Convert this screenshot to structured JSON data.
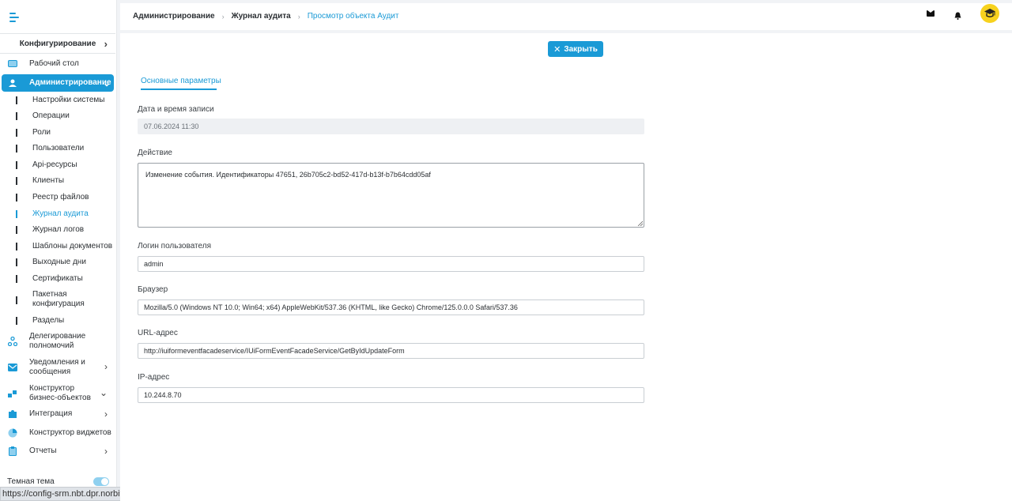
{
  "sidebar": {
    "config_label": "Конфигурирование",
    "items": [
      {
        "label": "Рабочий стол"
      },
      {
        "label": "Администрирование"
      },
      {
        "label": "Делегирование полномочий"
      },
      {
        "label": "Уведомления и сообщения"
      },
      {
        "label": "Конструктор бизнес-объектов"
      },
      {
        "label": "Интеграция"
      },
      {
        "label": "Конструктор виджетов"
      },
      {
        "label": "Отчеты"
      }
    ],
    "subitems": [
      {
        "label": "Настройки системы"
      },
      {
        "label": "Операции"
      },
      {
        "label": "Роли"
      },
      {
        "label": "Пользователи"
      },
      {
        "label": "Api-ресурсы"
      },
      {
        "label": "Клиенты"
      },
      {
        "label": "Реестр файлов"
      },
      {
        "label": "Журнал аудита"
      },
      {
        "label": "Журнал логов"
      },
      {
        "label": "Шаблоны документов"
      },
      {
        "label": "Выходные дни"
      },
      {
        "label": "Сертификаты"
      },
      {
        "label": "Пакетная конфигурация"
      },
      {
        "label": "Разделы"
      }
    ],
    "theme_label": "Темная тема"
  },
  "status_url": "https://config-srm.nbt.dpr.norbit.ru/audit",
  "header": {
    "breadcrumbs": [
      "Администрирование",
      "Журнал аудита",
      "Просмотр объекта Аудит"
    ]
  },
  "main": {
    "close_label": "Закрыть",
    "tab_label": "Основные параметры",
    "fields": {
      "datetime": {
        "label": "Дата и время записи",
        "value": "07.06.2024 11:30"
      },
      "action": {
        "label": "Действие",
        "value": "Изменение события. Идентификаторы 47651, 26b705c2-bd52-417d-b13f-b7b64cdd05af"
      },
      "login": {
        "label": "Логин пользователя",
        "value": "admin"
      },
      "browser": {
        "label": "Браузер",
        "value": "Mozilla/5.0 (Windows NT 10.0; Win64; x64) AppleWebKit/537.36 (KHTML, like Gecko) Chrome/125.0.0.0 Safari/537.36"
      },
      "url": {
        "label": "URL-адрес",
        "value": "http://iuiformeventfacadeservice/IUiFormEventFacadeService/GetByIdUpdateForm"
      },
      "ip": {
        "label": "IP-адрес",
        "value": "10.244.8.70"
      }
    }
  },
  "colors": {
    "accent": "#1a9ad6",
    "avatar": "#f7d21e"
  }
}
